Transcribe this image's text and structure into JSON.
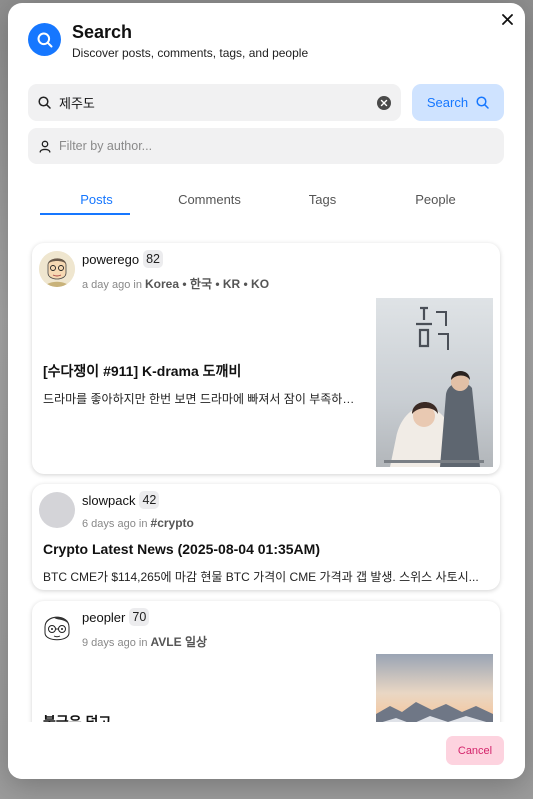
{
  "header": {
    "title": "Search",
    "subtitle": "Discover posts, comments, tags, and people"
  },
  "search": {
    "query": "제주도",
    "button_label": "Search",
    "author_placeholder": "Filter by author..."
  },
  "tabs": [
    {
      "label": "Posts",
      "active": true
    },
    {
      "label": "Comments",
      "active": false
    },
    {
      "label": "Tags",
      "active": false
    },
    {
      "label": "People",
      "active": false
    }
  ],
  "results": [
    {
      "author": "powerego",
      "reputation": "82",
      "time": "a day ago",
      "in": "in",
      "community": "Korea • 한국 • KR • KO",
      "title": "[수다쟁이 #911] K-drama 도깨비",
      "excerpt": "드라마를 좋아하지만 한번 보면 드라마에 빠져서 잠이 부족하게 ...",
      "thumbnail": "drama-poster"
    },
    {
      "author": "slowpack",
      "reputation": "42",
      "time": "6 days ago",
      "in": "in",
      "community": "#crypto",
      "title": "Crypto Latest News (2025-08-04 01:35AM)",
      "excerpt": "BTC CME가 $114,265에 마감 현물 BTC 가격이 CME 가격과 갭 발생. 스위스 사토시...",
      "thumbnail": ""
    },
    {
      "author": "peopler",
      "reputation": "70",
      "time": "9 days ago",
      "in": "in",
      "community": "AVLE 일상",
      "title": "불금은 덥고",
      "excerpt": "",
      "thumbnail": "sunset-mountain"
    }
  ],
  "footer": {
    "cancel_label": "Cancel"
  },
  "colors": {
    "accent": "#1677ff",
    "accent_soft": "#cfe3ff",
    "cancel_bg": "#fdd3df",
    "cancel_text": "#d4246b"
  },
  "icons": [
    "search-icon",
    "close-icon",
    "clear-icon",
    "user-icon"
  ]
}
